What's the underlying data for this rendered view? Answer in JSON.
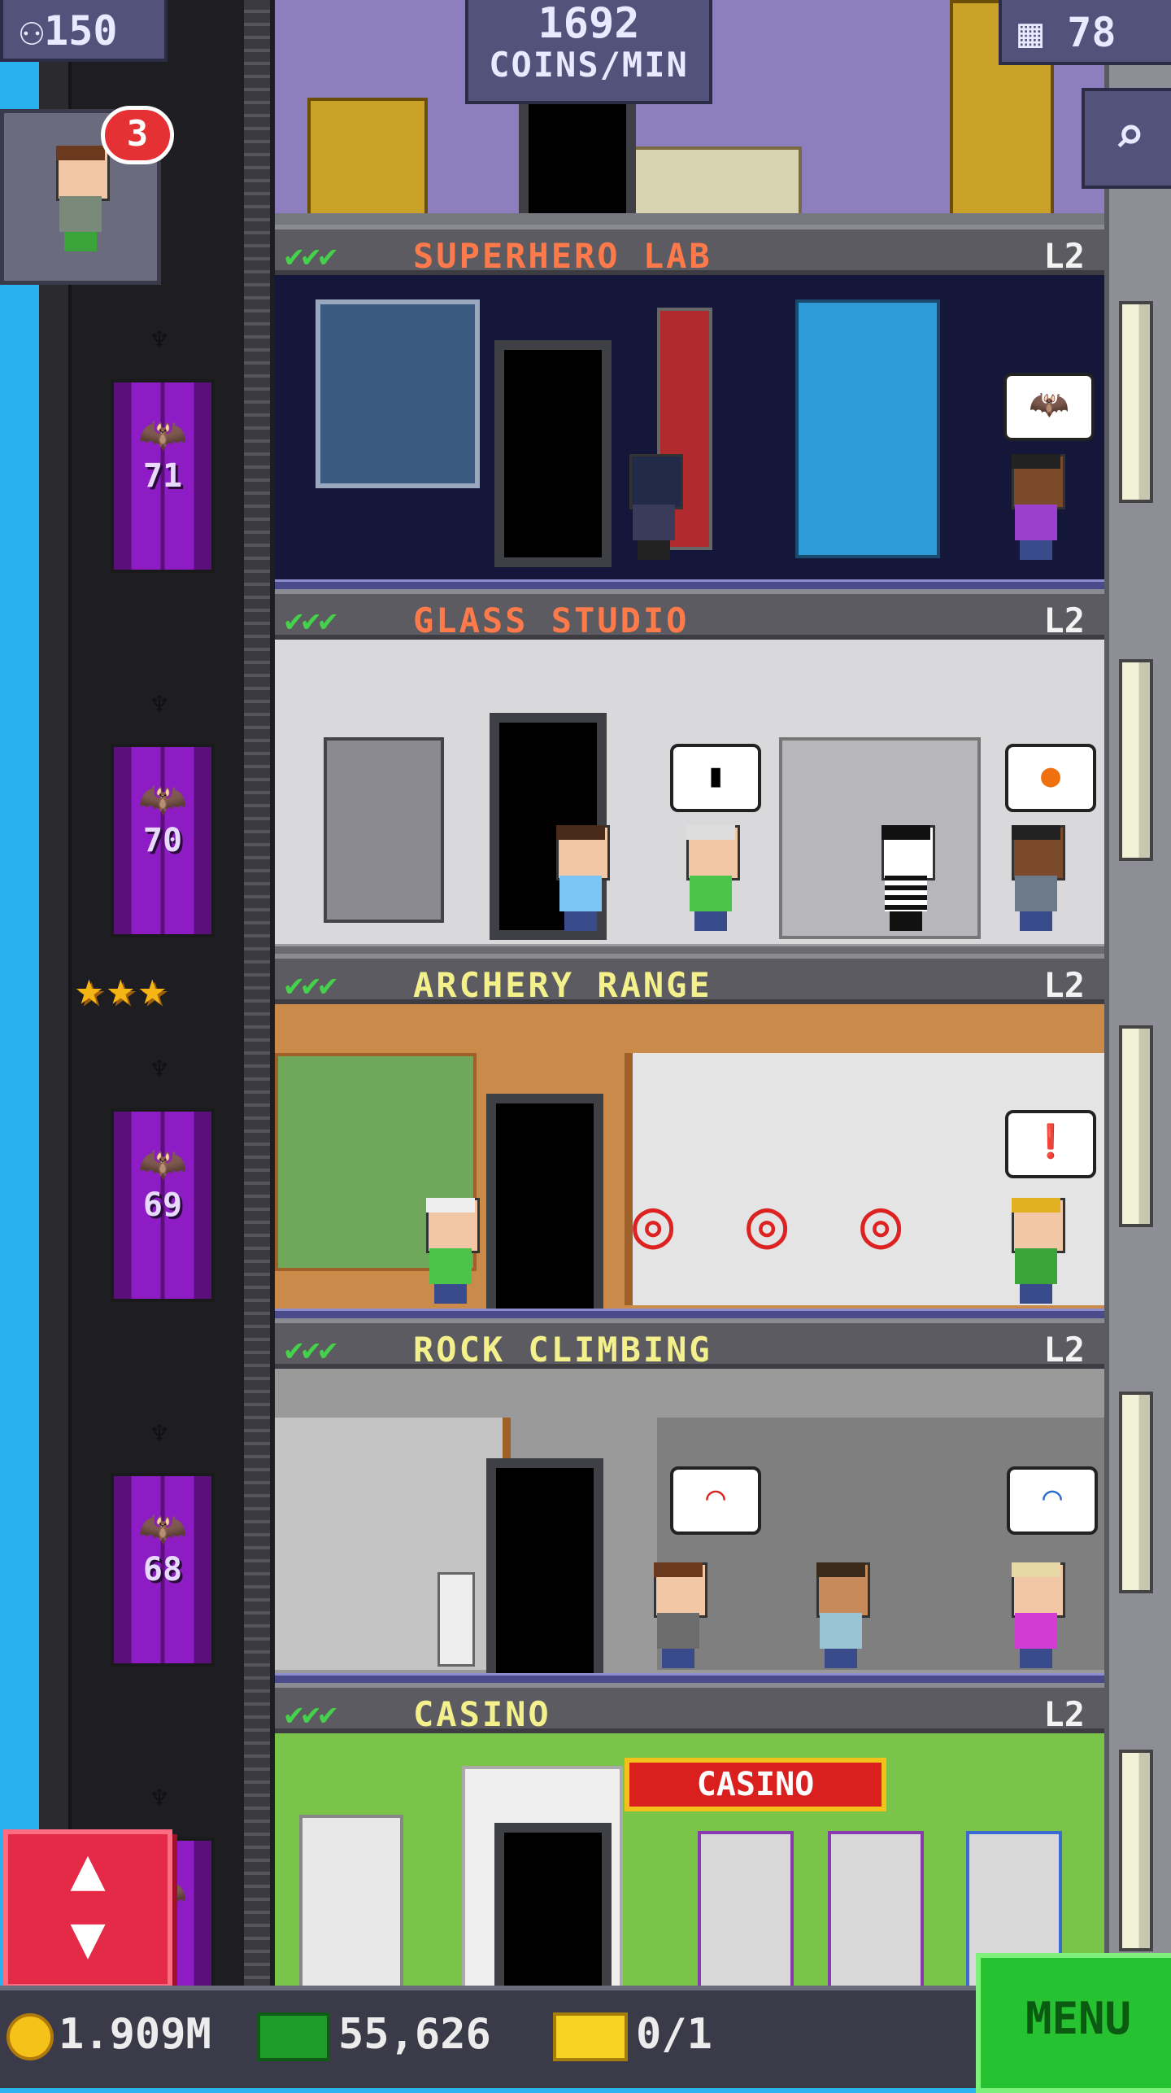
{
  "hud": {
    "population": "150",
    "coins_per_min_value": "1692",
    "coins_per_min_label": "COINS/MIN",
    "floors": "78",
    "visitor_badge": "3"
  },
  "elevator": {
    "floors": [
      "71",
      "70",
      "69",
      "68",
      "7"
    ]
  },
  "floors": [
    {
      "name": "SUPERHERO LAB",
      "level": "L2",
      "name_color": "#ff7a4a"
    },
    {
      "name": "GLASS STUDIO",
      "level": "L2",
      "name_color": "#ff7a4a"
    },
    {
      "name": "ARCHERY RANGE",
      "level": "L2",
      "name_color": "#f4f08c"
    },
    {
      "name": "ROCK CLIMBING",
      "level": "L2",
      "name_color": "#f4f08c"
    },
    {
      "name": "CASINO",
      "level": "L2",
      "name_color": "#f4f08c"
    }
  ],
  "casino_sign": "CASINO",
  "bottom": {
    "coins": "1.909M",
    "bux": "55,626",
    "tickets": "0/1",
    "menu": "MENU"
  },
  "colors": {
    "accent_green": "#26c232",
    "elevator_purple": "#8e1cc4",
    "hud_purple": "#52527a"
  }
}
